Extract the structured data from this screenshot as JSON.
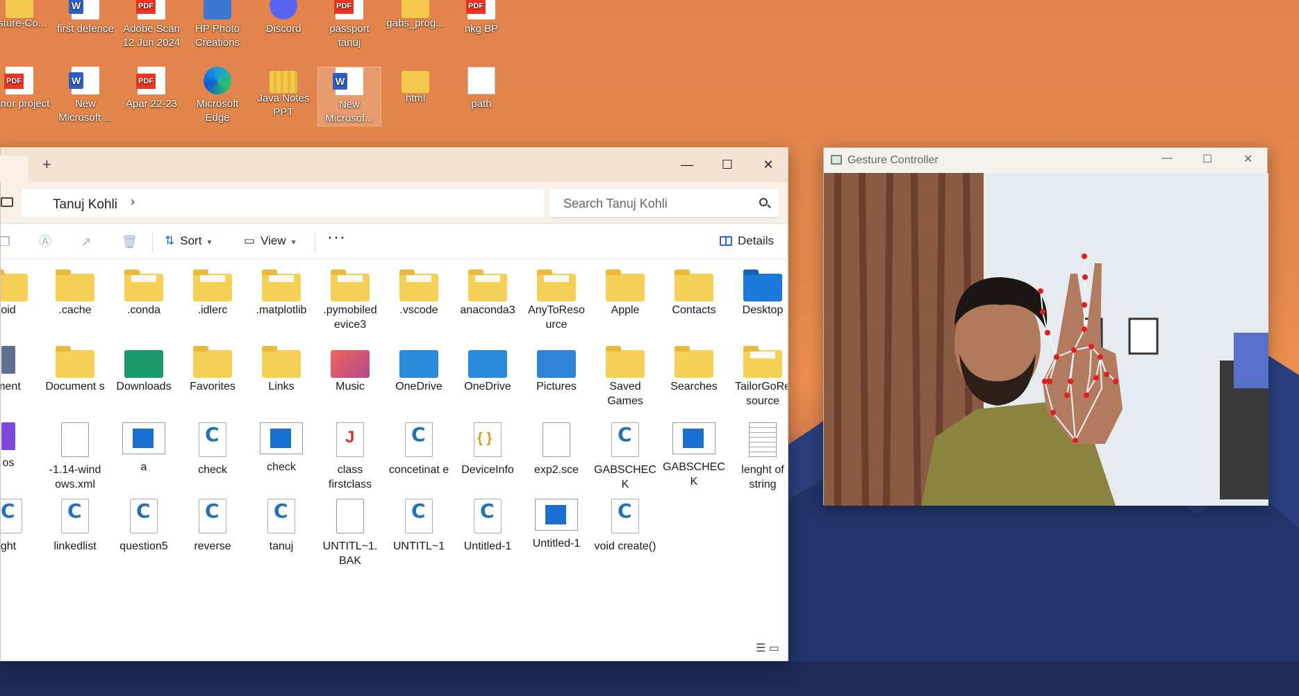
{
  "desktop": {
    "row1": [
      {
        "label": "esture-Co...",
        "icon": "folder"
      },
      {
        "label": "first defence",
        "icon": "word"
      },
      {
        "label": "Adobe Scan 12 Jun 2024",
        "icon": "pdf"
      },
      {
        "label": "HP Photo Creations",
        "icon": "photo"
      },
      {
        "label": "Discord",
        "icon": "discord"
      },
      {
        "label": "passport tanuj",
        "icon": "pdf"
      },
      {
        "label": "gabs_prog...",
        "icon": "folder"
      },
      {
        "label": "nkg BP",
        "icon": "pdf"
      }
    ],
    "row2": [
      {
        "label": "minor project",
        "icon": "pdf"
      },
      {
        "label": "New Microsoft ...",
        "icon": "word"
      },
      {
        "label": "Apar 22-23",
        "icon": "pdf"
      },
      {
        "label": "Microsoft Edge",
        "icon": "edge"
      },
      {
        "label": "Java Notes PPT",
        "icon": "zip"
      },
      {
        "label": "New Microsof...",
        "icon": "word"
      },
      {
        "label": "html",
        "icon": "folder"
      },
      {
        "label": "path",
        "icon": "doc"
      }
    ]
  },
  "explorer": {
    "tab_close": "✕",
    "tab_add": "+",
    "window_controls": {
      "minimize": "—",
      "maximize": "☐",
      "close": "✕"
    },
    "breadcrumb": "Tanuj Kohli",
    "chevron": "›",
    "search_placeholder": "Search Tanuj Kohli",
    "toolbar": {
      "sort_label": "Sort",
      "view_label": "View",
      "more_label": "···",
      "details_label": "Details"
    },
    "rows": [
      [
        {
          "label": "oid",
          "icon": "folder"
        },
        {
          "label": ".cache",
          "icon": "folder"
        },
        {
          "label": ".conda",
          "icon": "folder-paper"
        },
        {
          "label": ".idlerc",
          "icon": "folder-paper"
        },
        {
          "label": ".matplotlib",
          "icon": "folder-paper"
        },
        {
          "label": ".pymobiled evice3",
          "icon": "folder-paper"
        },
        {
          "label": ".vscode",
          "icon": "folder-paper"
        },
        {
          "label": "anaconda3",
          "icon": "folder-paper"
        },
        {
          "label": "AnyToReso urce",
          "icon": "folder-paper"
        },
        {
          "label": "Apple",
          "icon": "folder"
        },
        {
          "label": "Contacts",
          "icon": "folder"
        },
        {
          "label": "Desktop",
          "icon": "desktop"
        }
      ],
      [
        {
          "label": "ment",
          "icon": "grey"
        },
        {
          "label": "Document s",
          "icon": "folder"
        },
        {
          "label": "Downloads",
          "icon": "downloads"
        },
        {
          "label": "Favorites",
          "icon": "folder"
        },
        {
          "label": "Links",
          "icon": "folder"
        },
        {
          "label": "Music",
          "icon": "music"
        },
        {
          "label": "OneDrive",
          "icon": "onedrive"
        },
        {
          "label": "OneDrive",
          "icon": "onedrive"
        },
        {
          "label": "Pictures",
          "icon": "pictures"
        },
        {
          "label": "Saved Games",
          "icon": "folder"
        },
        {
          "label": "Searches",
          "icon": "folder"
        },
        {
          "label": "TailorGoRe source",
          "icon": "folder-paper"
        }
      ],
      [
        {
          "label": "os",
          "icon": "purple"
        },
        {
          "label": "-1.14-wind ows.xml",
          "icon": "doc"
        },
        {
          "label": "a",
          "icon": "app"
        },
        {
          "label": "check",
          "icon": "c"
        },
        {
          "label": "check",
          "icon": "app"
        },
        {
          "label": "class firstclass",
          "icon": "java"
        },
        {
          "label": "concetinat e",
          "icon": "c"
        },
        {
          "label": "DeviceInfo",
          "icon": "json"
        },
        {
          "label": "exp2.sce",
          "icon": "doc"
        },
        {
          "label": "GABSCHEC K",
          "icon": "c"
        },
        {
          "label": "GABSCHEC K",
          "icon": "app"
        },
        {
          "label": "lenght of string",
          "icon": "txt"
        }
      ],
      [
        {
          "label": "ght",
          "icon": "c"
        },
        {
          "label": "linkedlist",
          "icon": "c"
        },
        {
          "label": "question5",
          "icon": "c"
        },
        {
          "label": "reverse",
          "icon": "c"
        },
        {
          "label": "tanuj",
          "icon": "c"
        },
        {
          "label": "UNTITL~1. BAK",
          "icon": "doc"
        },
        {
          "label": "UNTITL~1",
          "icon": "c"
        },
        {
          "label": "Untitled-1",
          "icon": "c"
        },
        {
          "label": "Untitled-1",
          "icon": "app"
        },
        {
          "label": "void create()",
          "icon": "c"
        }
      ]
    ],
    "status_icons": "☰ ▭"
  },
  "gesture_window": {
    "title": "Gesture Controller",
    "controls": {
      "minimize": "—",
      "maximize": "☐",
      "close": "✕"
    }
  }
}
